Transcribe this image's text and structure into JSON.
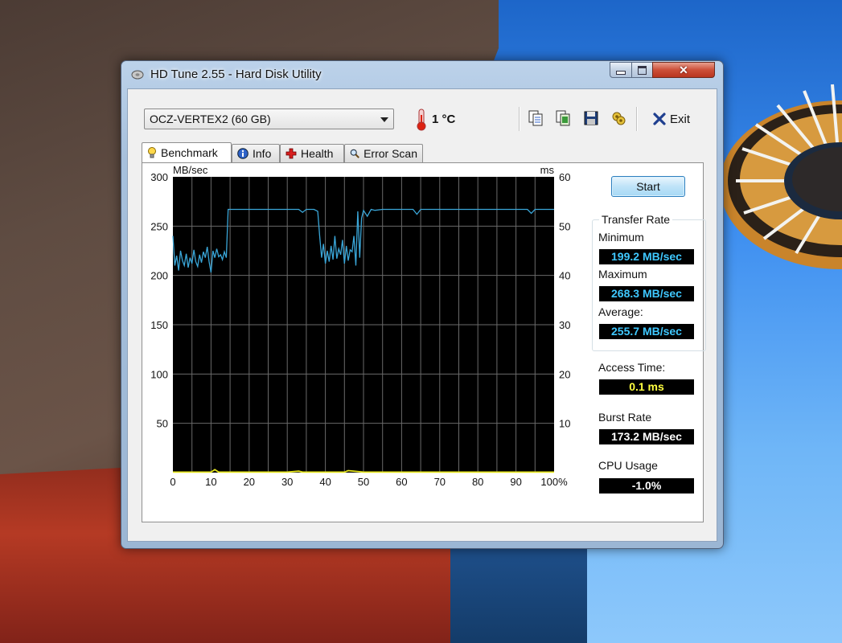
{
  "window": {
    "title": "HD Tune 2.55 - Hard Disk Utility"
  },
  "toolbar": {
    "drive": "OCZ-VERTEX2 (60 GB)",
    "temperature": "1 °C",
    "exit_label": "Exit"
  },
  "tabs": [
    {
      "label": "Benchmark",
      "active": true
    },
    {
      "label": "Info",
      "active": false
    },
    {
      "label": "Health",
      "active": false
    },
    {
      "label": "Error Scan",
      "active": false
    }
  ],
  "benchmark": {
    "start_label": "Start",
    "transfer_rate_title": "Transfer Rate",
    "minimum_label": "Minimum",
    "minimum_value": "199.2 MB/sec",
    "maximum_label": "Maximum",
    "maximum_value": "268.3 MB/sec",
    "average_label": "Average:",
    "average_value": "255.7 MB/sec",
    "access_time_label": "Access Time:",
    "access_time_value": "0.1 ms",
    "burst_rate_label": "Burst Rate",
    "burst_rate_value": "173.2 MB/sec",
    "cpu_usage_label": "CPU Usage",
    "cpu_usage_value": "-1.0%"
  },
  "colors": {
    "lcd_blue": "#3fc8ff",
    "lcd_yellow": "#ffff40",
    "lcd_white": "#ffffff",
    "transfer_line": "#3aa6d8",
    "access_line": "#e8e820",
    "plot_bg": "#000000",
    "grid": "#6a6a6a"
  },
  "chart_data": {
    "type": "line",
    "left_axis_unit": "MB/sec",
    "right_axis_unit": "ms",
    "ylim_left": [
      0,
      300
    ],
    "ylim_right": [
      0,
      60
    ],
    "y_ticks_left": [
      "300",
      "250",
      "200",
      "150",
      "100",
      "50"
    ],
    "y_ticks_right": [
      "60",
      "50",
      "40",
      "30",
      "20",
      "10"
    ],
    "x_ticks": [
      "0",
      "10",
      "20",
      "30",
      "40",
      "50",
      "60",
      "70",
      "80",
      "90",
      "100%"
    ],
    "grid": true,
    "series": [
      {
        "x": [
          0,
          0.5,
          1,
          1.5,
          2,
          2.5,
          3,
          3.5,
          4,
          4.5,
          5,
          5.5,
          6,
          6.5,
          7,
          7.5,
          8,
          8.5,
          9,
          9.5,
          10,
          10.5,
          11,
          11.5,
          12,
          12.5,
          13,
          13.5,
          14,
          14.5,
          15,
          20,
          25,
          30,
          33,
          34,
          35,
          36,
          37,
          38,
          38.5,
          39,
          39.5,
          40,
          40.5,
          41,
          41.5,
          42,
          42.5,
          43,
          43.5,
          44,
          44.5,
          45,
          45.5,
          46,
          46.5,
          47,
          47.5,
          48,
          48.5,
          49,
          49.5,
          50,
          51,
          52,
          53,
          55,
          60,
          62,
          63,
          64,
          65,
          70,
          75,
          80,
          85,
          90,
          92,
          93,
          94,
          95,
          100
        ],
        "y": [
          240,
          210,
          220,
          205,
          225,
          215,
          210,
          222,
          208,
          218,
          212,
          226,
          214,
          209,
          221,
          213,
          224,
          218,
          229,
          214,
          203,
          225,
          218,
          227,
          219,
          221,
          216,
          224,
          218,
          267,
          267,
          267,
          267,
          267,
          267,
          264,
          267,
          267,
          267,
          265,
          240,
          218,
          232,
          212,
          225,
          214,
          230,
          216,
          240,
          217,
          227,
          221,
          236,
          212,
          230,
          215,
          226,
          224,
          240,
          210,
          265,
          218,
          258,
          266,
          260,
          267,
          266,
          267,
          267,
          267,
          267,
          262,
          267,
          267,
          267,
          267,
          267,
          267,
          267,
          267,
          263,
          267,
          267
        ],
        "stroke": "#3aa6d8"
      },
      {
        "name": "access time (ms)",
        "x": [
          0,
          10,
          11,
          12,
          20,
          30,
          33,
          34,
          40,
          45,
          46,
          50,
          60,
          70,
          80,
          90,
          100
        ],
        "y": [
          0.1,
          0.1,
          0.6,
          0.1,
          0.1,
          0.1,
          0.3,
          0.1,
          0.1,
          0.1,
          0.4,
          0.1,
          0.1,
          0.1,
          0.1,
          0.1,
          0.1
        ],
        "stroke": "#e8e820",
        "axis": "right"
      }
    ]
  }
}
